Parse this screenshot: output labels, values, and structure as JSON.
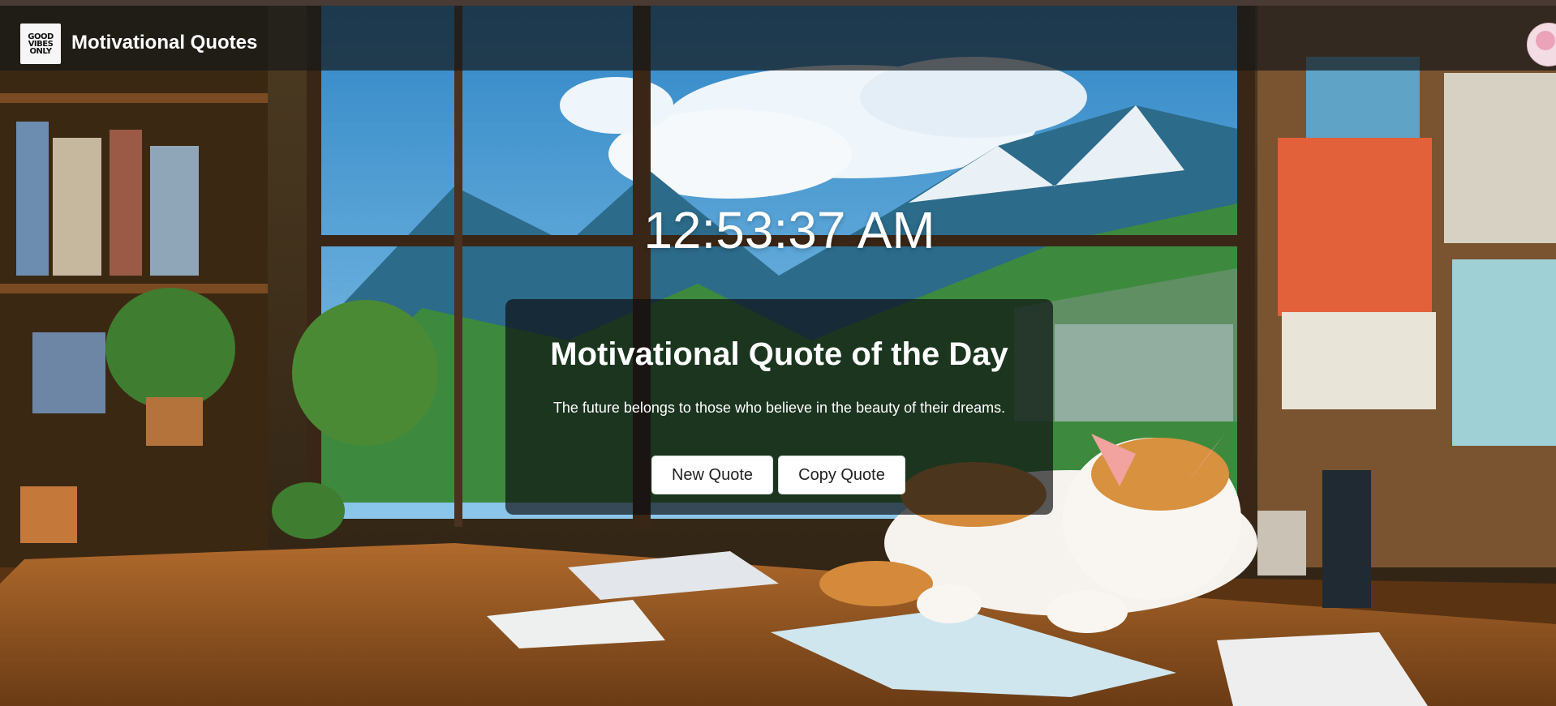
{
  "header": {
    "logo_text": "GOOD VIBES ONLY",
    "title": "Motivational Quotes",
    "avatar_icon": "user-avatar-icon"
  },
  "clock": {
    "time": "12:53:37 AM"
  },
  "quote_card": {
    "heading": "Motivational Quote of the Day",
    "quote": "The future belongs to those who believe in the beauty of their dreams.",
    "new_quote_label": "New Quote",
    "copy_quote_label": "Copy Quote"
  },
  "colors": {
    "navbar": "#16181a",
    "card": "#0c0e10",
    "button_bg": "#ffffff",
    "text": "#ffffff"
  }
}
